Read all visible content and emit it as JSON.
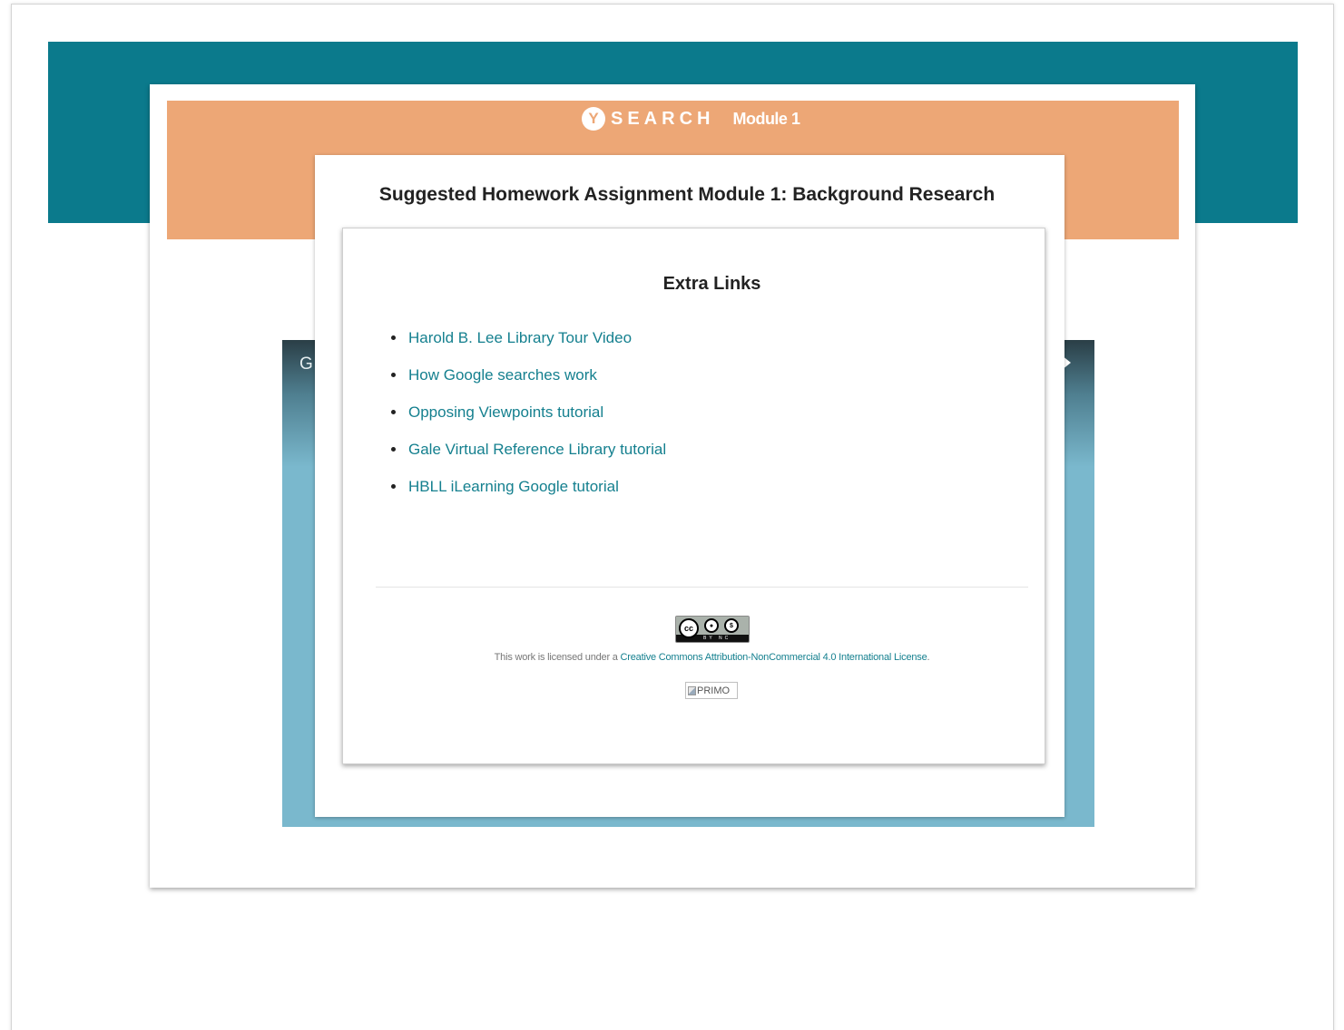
{
  "header": {
    "brand_logo_letter": "Y",
    "brand_word": "SEARCH",
    "module_label": "Module 1"
  },
  "background_panel": {
    "partial_text": "G"
  },
  "homework": {
    "title": "Suggested Homework Assignment Module 1: Background Research"
  },
  "extra_links": {
    "heading": "Extra Links",
    "items": [
      {
        "label": "Harold B. Lee Library Tour Video"
      },
      {
        "label": "How Google searches work"
      },
      {
        "label": "Opposing Viewpoints tutorial"
      },
      {
        "label": "Gale Virtual Reference Library tutorial"
      },
      {
        "label": "HBLL iLearning Google tutorial"
      }
    ]
  },
  "license": {
    "badge_cc": "cc",
    "badge_by": "BY",
    "badge_nc": "NC",
    "prefix": "This work is licensed under a ",
    "link_text": "Creative Commons Attribution-NonCommercial 4.0 International License",
    "suffix": "."
  },
  "primo": {
    "alt_text": "PRIMO"
  },
  "colors": {
    "teal_banner": "#0b7a8c",
    "orange_header": "#eda776",
    "link": "#15808f",
    "panel_blue": "#7ab8cd"
  },
  "icons": {
    "brand": "y-circle-logo",
    "license": "creative-commons-badge",
    "arrow": "next-arrow-icon",
    "broken_image": "broken-image-icon"
  }
}
